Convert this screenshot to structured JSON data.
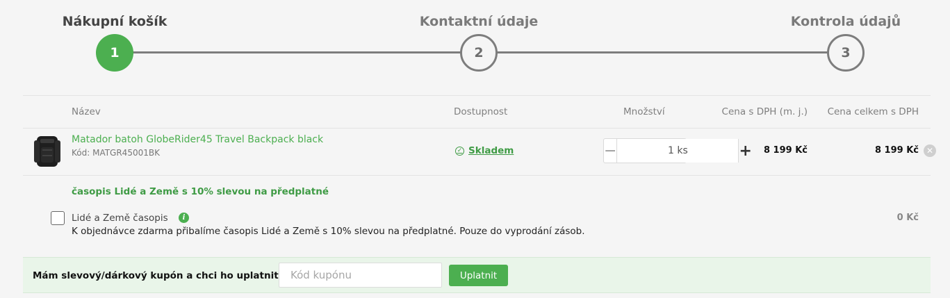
{
  "stepper": {
    "steps": [
      {
        "label": "Nákupní košík",
        "number": "1",
        "state": "active"
      },
      {
        "label": "Kontaktní údaje",
        "number": "2",
        "state": "inactive"
      },
      {
        "label": "Kontrola údajů",
        "number": "3",
        "state": "inactive"
      }
    ]
  },
  "table": {
    "headers": {
      "name": "Název",
      "availability": "Dostupnost",
      "quantity": "Množství",
      "unit_price": "Cena s DPH (m. j.)",
      "total_price": "Cena celkem s DPH"
    },
    "item": {
      "name": "Matador batoh GlobeRider45 Travel Backpack black",
      "code": "Kód: MATGR45001BK",
      "availability": "Skladem",
      "quantity": "1 ks",
      "unit_price": "8 199 Kč",
      "total_price": "8 199 Kč",
      "image_icon": "backpack-image"
    }
  },
  "promo": {
    "title": "časopis Lidé a Země s 10% slevou na předplatné",
    "name": "Lidé a Země časopis",
    "description": "K objednávce zdarma přibalíme časopis Lidé a Země s 10% slevou na předplatné. Pouze do vyprodání zásob.",
    "price": "0 Kč",
    "checked": false
  },
  "coupon": {
    "label": "Mám slevový/dárkový kupón a chci ho uplatnit:",
    "placeholder": "Kód kupónu",
    "button": "Uplatnit"
  },
  "colors": {
    "accent": "#4caf50",
    "background": "#f5f5f5",
    "coupon_bg": "#e9f5e9",
    "step_inactive": "#7d7d7d"
  }
}
